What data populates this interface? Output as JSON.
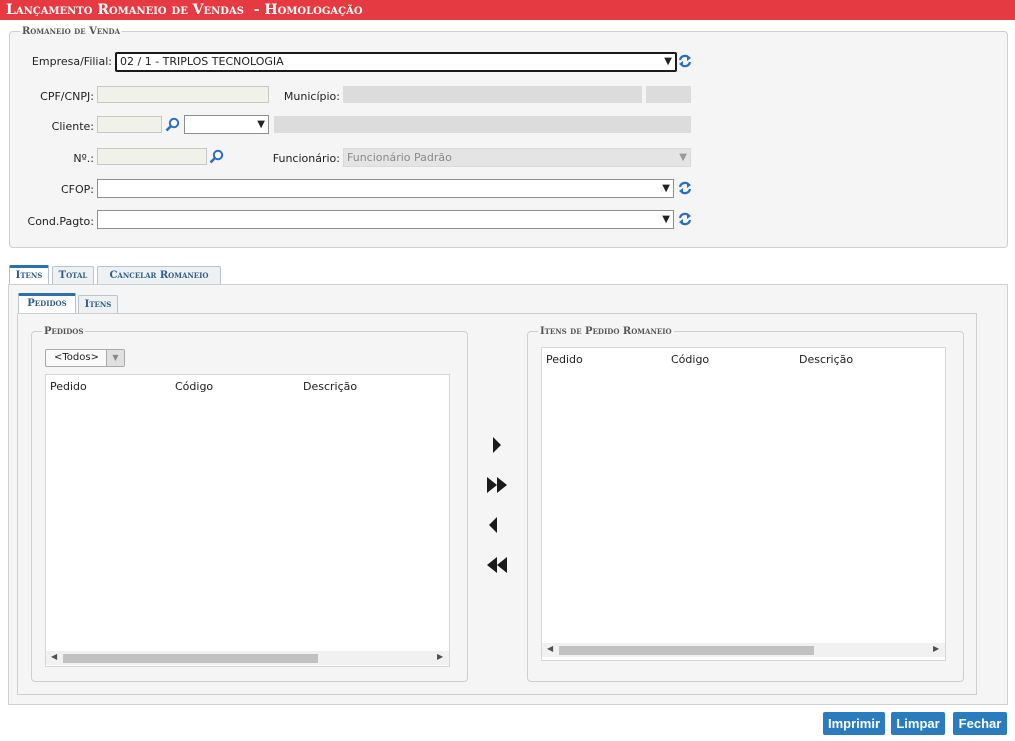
{
  "app": {
    "title": "Lançamento Romaneio de Vendas  - Homologação"
  },
  "romaneio": {
    "legend": "Romaneio de Venda",
    "empresa_label": "Empresa/Filial:",
    "empresa_value": "02 / 1 - TRIPLOS TECNOLOGIA",
    "cpf_label": "CPF/CNPJ:",
    "municipio_label": "Município:",
    "cliente_label": "Cliente:",
    "numero_label": "Nº.:",
    "funcionario_label": "Funcionário:",
    "funcionario_value": "Funcionário Padrão",
    "cfop_label": "CFOP:",
    "condpagto_label": "Cond.Pagto:"
  },
  "tabs": [
    "Itens",
    "Total",
    "Cancelar Romaneio"
  ],
  "subtabs": [
    "Pedidos",
    "Itens"
  ],
  "pedidos": {
    "legend": "Pedidos",
    "filter": "<Todos>",
    "columns": [
      "Pedido",
      "Código",
      "Descrição"
    ]
  },
  "itens_pedido": {
    "legend": "Itens de Pedido Romaneio",
    "columns": [
      "Pedido",
      "Código",
      "Descrição"
    ]
  },
  "buttons": {
    "imprimir": "Imprimir",
    "limpar": "Limpar",
    "fechar": "Fechar"
  },
  "colors": {
    "title_bar": "#e63a43",
    "button": "#2a7cbf",
    "refresh_icon": "#2a6fbf",
    "tab_accent": "#2e6fa6"
  }
}
